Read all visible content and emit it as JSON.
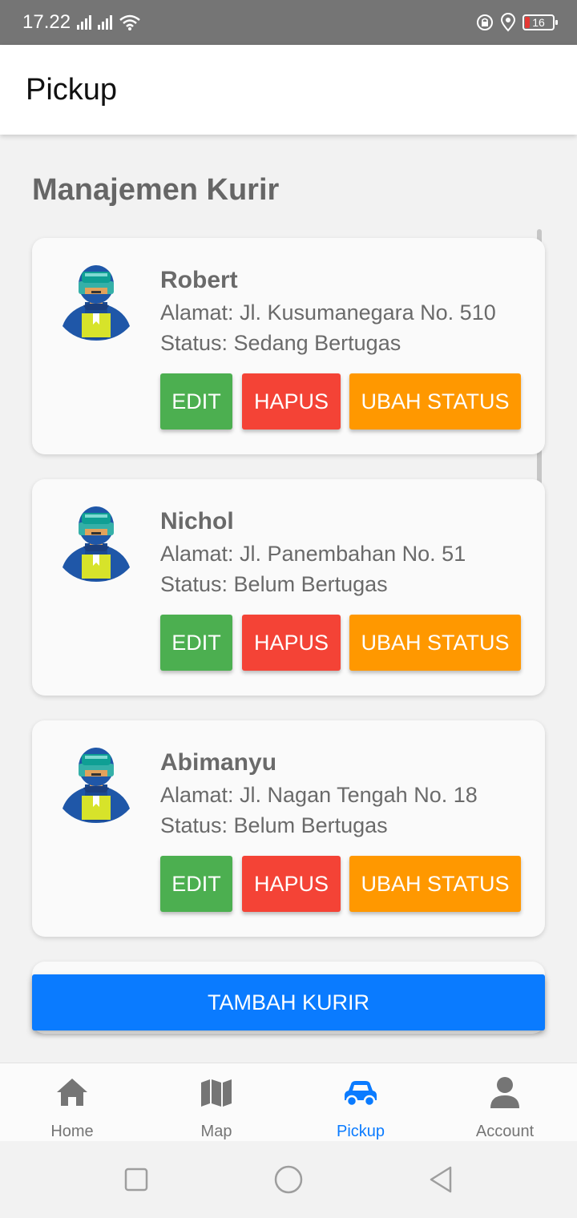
{
  "status_bar": {
    "time": "17.22",
    "battery": "16"
  },
  "app_bar": {
    "title": "Pickup"
  },
  "section": {
    "title": "Manajemen Kurir"
  },
  "couriers": [
    {
      "name": "Robert",
      "address": "Alamat: Jl. Kusumanegara No. 510",
      "status": "Status: Sedang Bertugas"
    },
    {
      "name": "Nichol",
      "address": "Alamat: Jl. Panembahan No. 51",
      "status": "Status: Belum Bertugas"
    },
    {
      "name": "Abimanyu",
      "address": "Alamat: Jl. Nagan Tengah No. 18",
      "status": "Status: Belum Bertugas"
    }
  ],
  "buttons": {
    "edit": "EDIT",
    "delete": "HAPUS",
    "change_status": "UBAH STATUS",
    "add": "TAMBAH KURIR"
  },
  "nav": [
    {
      "label": "Home",
      "icon": "home-icon"
    },
    {
      "label": "Map",
      "icon": "map-icon"
    },
    {
      "label": "Pickup",
      "icon": "car-icon",
      "active": true
    },
    {
      "label": "Account",
      "icon": "account-icon"
    }
  ],
  "colors": {
    "edit": "#4caf50",
    "delete": "#f44336",
    "change_status": "#ff9800",
    "primary": "#0a7bff"
  }
}
